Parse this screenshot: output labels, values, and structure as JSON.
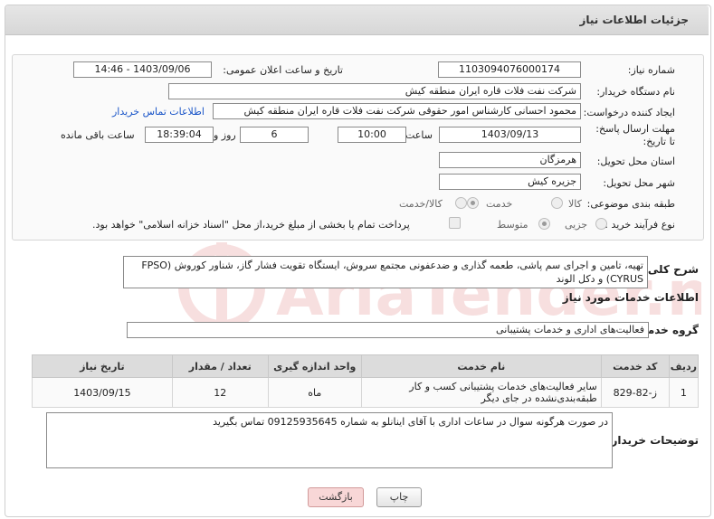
{
  "header": {
    "title": "جزئیات اطلاعات نیاز"
  },
  "form": {
    "need_number": {
      "label": "شماره نیاز:",
      "value": "1103094076000174"
    },
    "announce_date": {
      "label": "تاریخ و ساعت اعلان عمومی:",
      "value": "1403/09/06 - 14:46"
    },
    "buyer_org": {
      "label": "نام دستگاه خریدار:",
      "value": "شرکت نفت فلات قاره ایران منطقه کیش"
    },
    "requester": {
      "label": "ایجاد کننده درخواست:",
      "value": "محمود  احسانی  کارشناس امور حقوقی  شرکت نفت فلات قاره ایران منطقه کیش",
      "contact_link": "اطلاعات تماس خریدار"
    },
    "deadline": {
      "label": "مهلت ارسال پاسخ: تا تاریخ:",
      "date": "1403/09/13",
      "time_label": "ساعت",
      "time": "10:00",
      "days": "6",
      "days_label": "روز و",
      "remaining": "18:39:04",
      "remaining_label": "ساعت باقی مانده"
    },
    "province": {
      "label": "استان محل تحویل:",
      "value": "هرمزگان"
    },
    "city": {
      "label": "شهر محل تحویل:",
      "value": "جزیره کیش"
    },
    "category": {
      "label": "طبقه بندی موضوعی:",
      "options": [
        "کالا",
        "خدمت",
        "کالا/خدمت"
      ],
      "selected": "خدمت"
    },
    "process": {
      "label": "نوع فرآیند خرید :",
      "options": [
        "جزیی",
        "متوسط"
      ],
      "selected": "متوسط",
      "payment_note": "پرداخت تمام یا بخشی از مبلغ خرید،از محل \"اسناد خزانه اسلامی\" خواهد بود."
    }
  },
  "description": {
    "label": "شرح کلی نیاز:",
    "text": "تهیه، تامین و اجرای سم پاشی، طعمه گذاری و ضدعفونی مجتمع سروش، ایستگاه تقویت فشار گاز، شناور کوروش (FPSO CYRUS) و دکل الوند"
  },
  "services_section": {
    "title": "اطلاعات خدمات مورد نیاز"
  },
  "service_group": {
    "label": "گروه خدمت:",
    "value": "فعالیت‌های اداری و خدمات پشتیبانی"
  },
  "table": {
    "headers": [
      "ردیف",
      "کد خدمت",
      "نام خدمت",
      "واحد اندازه گیری",
      "تعداد / مقدار",
      "تاریخ نیاز"
    ],
    "rows": [
      [
        "1",
        "ز-82-829",
        "سایر فعالیت‌های خدمات پشتیبانی کسب و کار طبقه‌بندی‌نشده در جای دیگر",
        "ماه",
        "12",
        "1403/09/15"
      ]
    ]
  },
  "buyer_notes": {
    "label": "توضیحات خریدار:",
    "text": "در صورت هرگونه سوال در ساعات اداری با آقای اینانلو به شماره 09125935645 تماس بگیرید"
  },
  "buttons": {
    "print": "چاپ",
    "back": "بازگشت"
  },
  "watermark_text": "AriaTender.neT",
  "colors": {
    "link": "#1a55c8",
    "back_button": "#f8d7d7",
    "header_bg": "#dcdcdc"
  }
}
